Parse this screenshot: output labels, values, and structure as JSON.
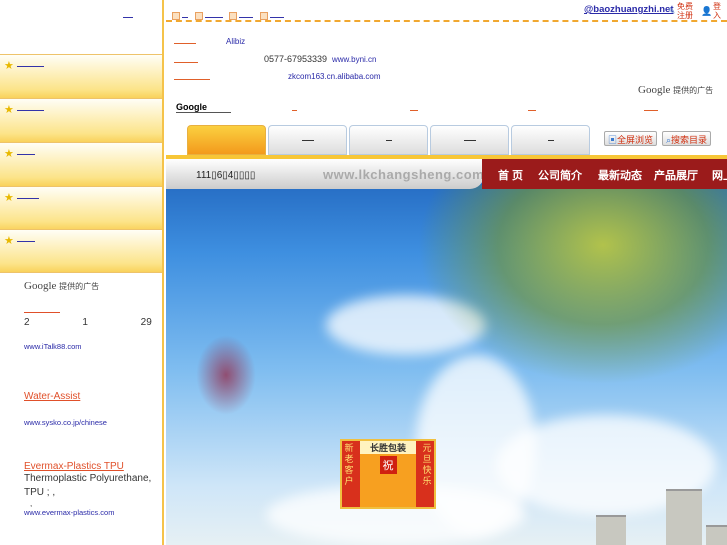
{
  "sidebar": {
    "items": [
      {
        "icon": "star-icon"
      },
      {
        "icon": "star-icon"
      },
      {
        "icon": "star-icon"
      },
      {
        "icon": "star-icon"
      },
      {
        "icon": "star-icon"
      }
    ],
    "ads": {
      "google_label": "Google",
      "google_suffix": "提供的广告",
      "ad1": {
        "line": "2 1 29",
        "url": "www.iTalk88.com"
      },
      "ad2": {
        "title": "Water-Assist",
        "url": "www.sysko.co.jp/chinese"
      },
      "ad3": {
        "title": "Evermax-Plastics TPU",
        "body": "Thermoplastic Polyurethane, TPU ; ,",
        "extra": ",",
        "url": "www.evermax-plastics.com"
      }
    }
  },
  "topbar": {
    "email": "@baozhuangzhi.net",
    "register": "免费注册",
    "login": "登入"
  },
  "info": {
    "alibiz": "Alibiz",
    "phone": "0577-67953339",
    "phone_url": "www.byni.cn",
    "shop_url": "zkcom163.cn.alibaba.com",
    "google_search": "Google",
    "google_ads_label": "Google",
    "google_ads_suffix": "提供的广告"
  },
  "buttons": {
    "fullscreen": "全屏浏览",
    "search_dir": "搜索目录"
  },
  "banner": {
    "date": "111▯6▯4▯▯▯▯",
    "site": "www.lkchangsheng.com",
    "nav": [
      "首 页",
      "公司简介",
      "最新动态",
      "产品展厅",
      "网上"
    ],
    "badge": {
      "title": "长胜包装",
      "center": "祝",
      "left": "新老客户",
      "right": "元旦快乐"
    }
  }
}
